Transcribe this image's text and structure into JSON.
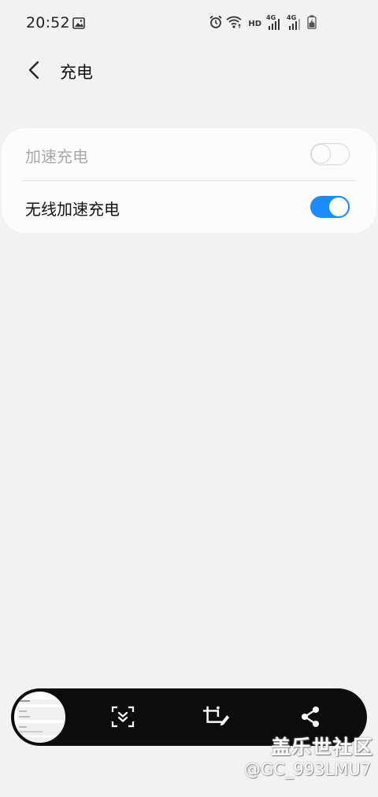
{
  "status_bar": {
    "time": "20:52",
    "hd": "HD",
    "network_1": "4G",
    "network_2": "4G",
    "icons": [
      "gallery-icon",
      "alarm-icon",
      "wifi-icon",
      "signal-icon",
      "signal-icon",
      "battery-charging-icon"
    ]
  },
  "header": {
    "title": "充电",
    "back_icon": "chevron-left-icon"
  },
  "settings": [
    {
      "label": "加速充电",
      "enabled": false,
      "checked": false
    },
    {
      "label": "无线加速充电",
      "enabled": true,
      "checked": true
    }
  ],
  "colors": {
    "accent": "#1a8cff",
    "background": "#f2f2f2",
    "card": "#fcfcfc",
    "toolbar": "#0c0c0c"
  },
  "screenshot_toolbar": {
    "icons": [
      "thumbnail-preview",
      "scroll-capture-icon",
      "crop-edit-icon",
      "share-icon"
    ]
  },
  "watermark": {
    "brand": "盖乐世社区",
    "user": "@GC_993LMU7"
  }
}
